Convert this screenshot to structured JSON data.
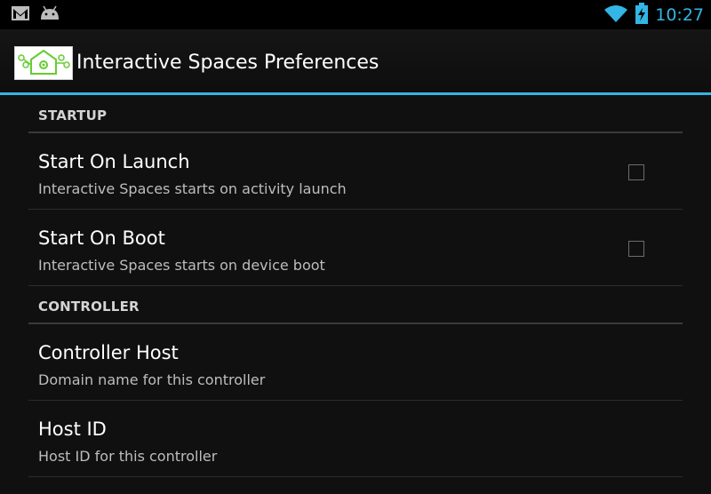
{
  "status_bar": {
    "left_icons": [
      "gmail-icon",
      "android-icon"
    ],
    "right_icons": [
      "wifi-icon",
      "battery-charging-icon"
    ],
    "time": "10:27"
  },
  "action_bar": {
    "title": "Interactive Spaces Preferences",
    "logo": "interactive-spaces-logo",
    "accent_color": "#33b5e5"
  },
  "sections": [
    {
      "header": "STARTUP",
      "items": [
        {
          "title": "Start On Launch",
          "summary": "Interactive Spaces starts on activity launch",
          "checked": false
        },
        {
          "title": "Start On Boot",
          "summary": "Interactive Spaces starts on device boot",
          "checked": false
        }
      ]
    },
    {
      "header": "CONTROLLER",
      "items": [
        {
          "title": "Controller Host",
          "summary": "Domain name for this controller"
        },
        {
          "title": "Host ID",
          "summary": "Host ID for this controller"
        }
      ]
    }
  ]
}
